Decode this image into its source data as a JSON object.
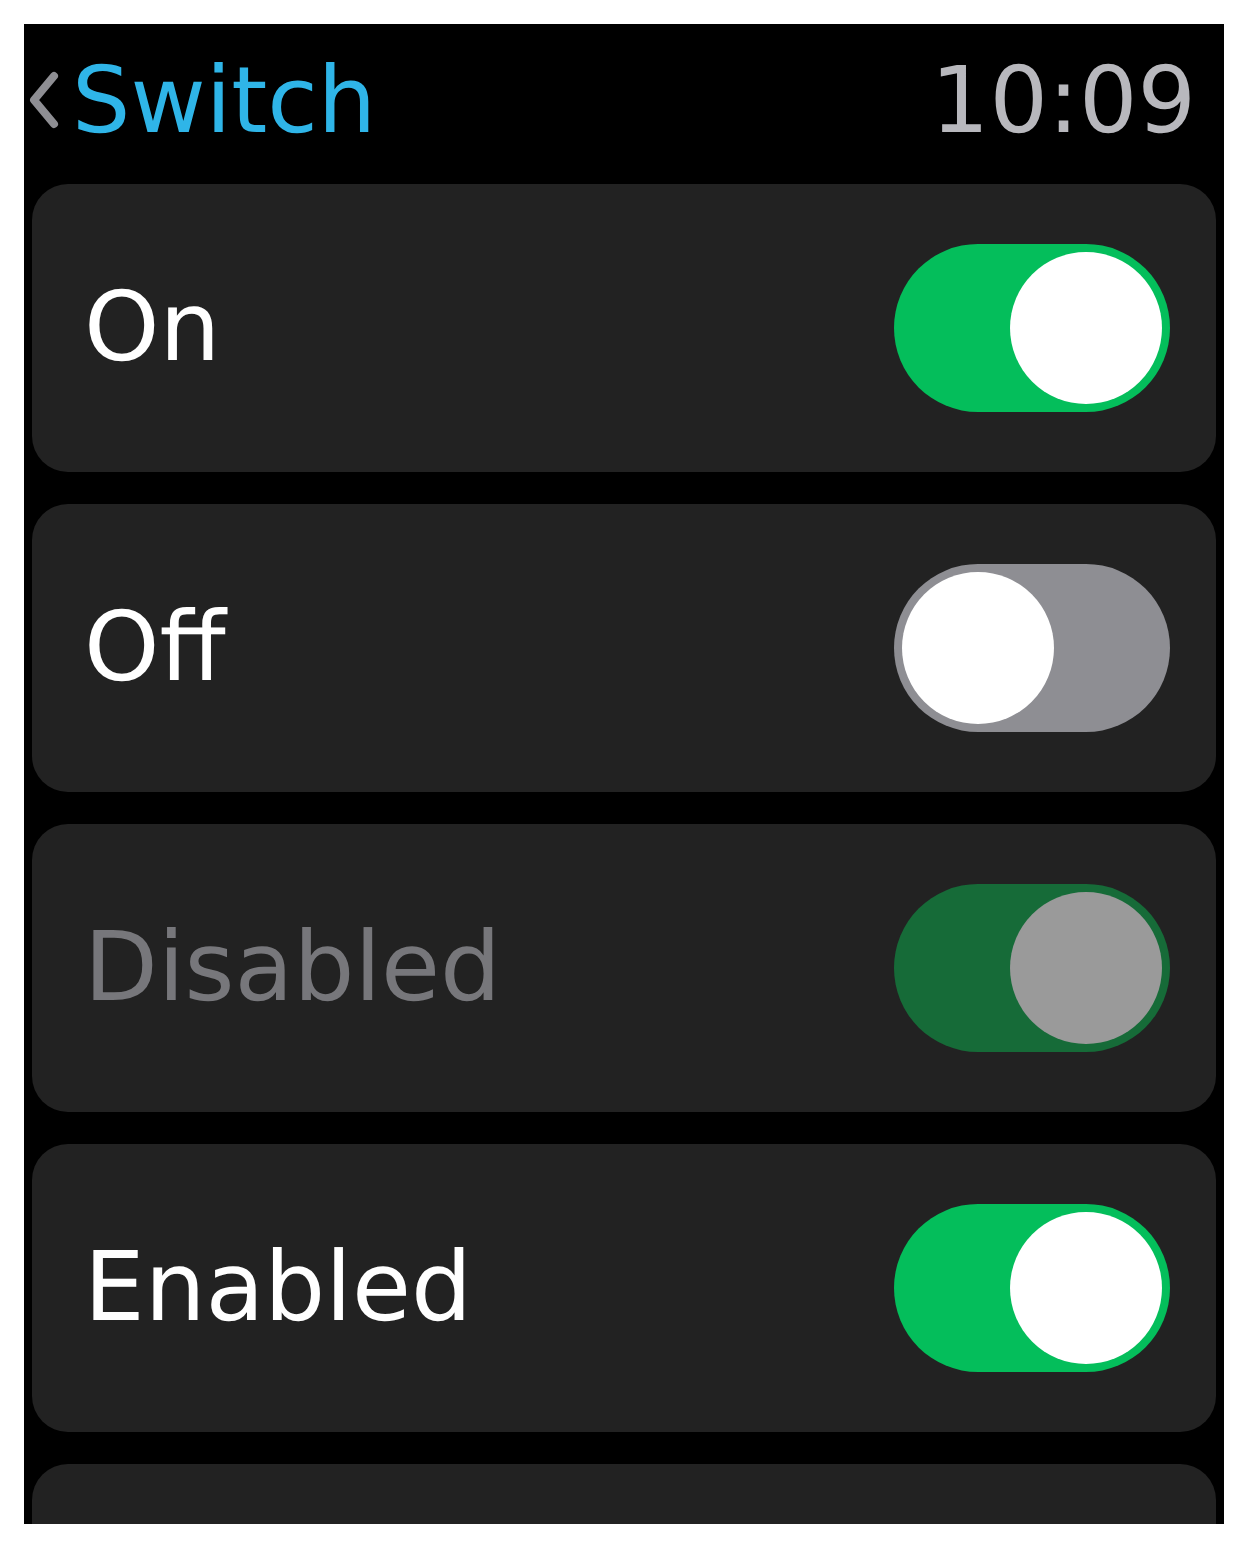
{
  "header": {
    "title": "Switch",
    "time": "10:09"
  },
  "rows": [
    {
      "label": "On",
      "on": true,
      "disabled": false
    },
    {
      "label": "Off",
      "on": false,
      "disabled": false
    },
    {
      "label": "Disabled",
      "on": true,
      "disabled": true
    },
    {
      "label": "Enabled",
      "on": true,
      "disabled": false
    }
  ]
}
